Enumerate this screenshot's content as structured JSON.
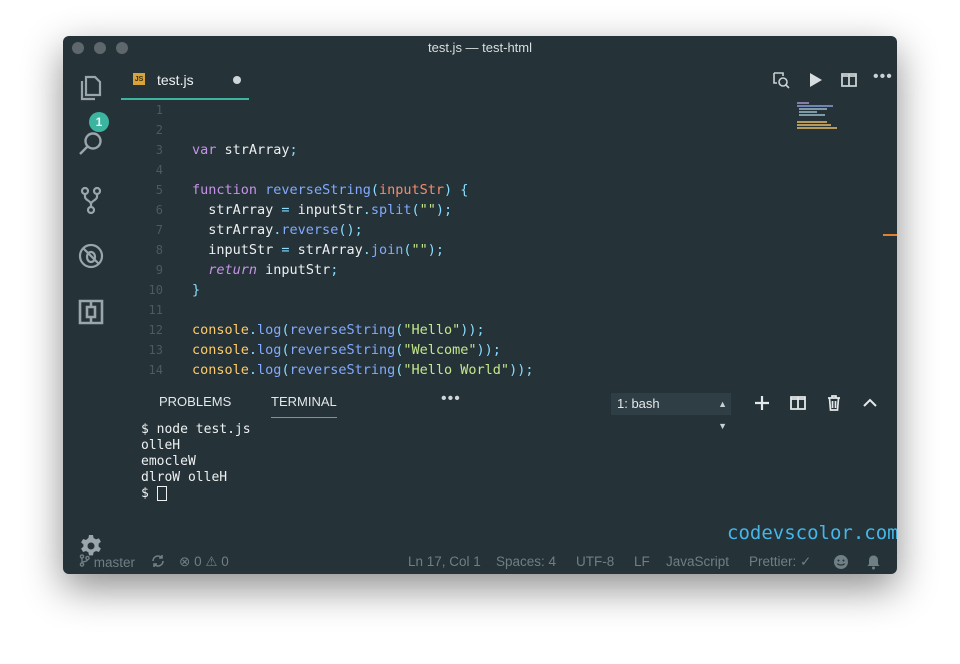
{
  "window": {
    "title": "test.js — test-html"
  },
  "activity_bar": {
    "explorer_badge": "1"
  },
  "tab": {
    "filename": "test.js",
    "file_icon": "JS"
  },
  "editor": {
    "line_numbers": [
      "1",
      "2",
      "3",
      "4",
      "5",
      "6",
      "7",
      "8",
      "9",
      "10",
      "11",
      "12",
      "13",
      "14"
    ],
    "lines": [
      "",
      "var strArray;",
      "",
      "function reverseString(inputStr) {",
      "  strArray = inputStr.split(\"\");",
      "  strArray.reverse();",
      "  inputStr = strArray.join(\"\");",
      "  return inputStr;",
      "}",
      "",
      "console.log(reverseString(\"Hello\"));",
      "console.log(reverseString(\"Welcome\"));",
      "console.log(reverseString(\"Hello World\"));",
      ""
    ]
  },
  "panel": {
    "tabs": [
      "PROBLEMS",
      "TERMINAL"
    ],
    "active_tab": "TERMINAL",
    "more": "•••",
    "terminal_select": "1: bash",
    "terminal_output": [
      "$ node test.js",
      "olleH",
      "emocleW",
      "dlroW olleH",
      "$ "
    ]
  },
  "watermark": "codevscolor.com",
  "status_bar": {
    "branch": "master",
    "errors": "0",
    "warnings": "0",
    "position": "Ln 17, Col 1",
    "spaces": "Spaces: 4",
    "encoding": "UTF-8",
    "eol": "LF",
    "language": "JavaScript",
    "prettier": "Prettier: ✓"
  },
  "icons": [
    "files-icon",
    "search-icon",
    "source-control-icon",
    "debug-icon",
    "extensions-icon",
    "settings-gear-icon",
    "open-changes-icon",
    "run-icon",
    "split-editor-icon",
    "more-actions-icon",
    "new-terminal-icon",
    "split-terminal-icon",
    "trash-icon",
    "maximize-panel-icon",
    "toggle-panel-icon",
    "close-panel-icon",
    "git-branch-icon",
    "sync-icon",
    "error-icon",
    "warning-icon",
    "feedback-smiley-icon",
    "bell-icon"
  ],
  "colors": {
    "background": "#253238",
    "accent": "#3bb5a0",
    "keyword": "#c792ea",
    "function": "#82aaff",
    "string": "#c3e88d",
    "parameter": "#f78c6c",
    "watermark": "#45b6e8"
  }
}
